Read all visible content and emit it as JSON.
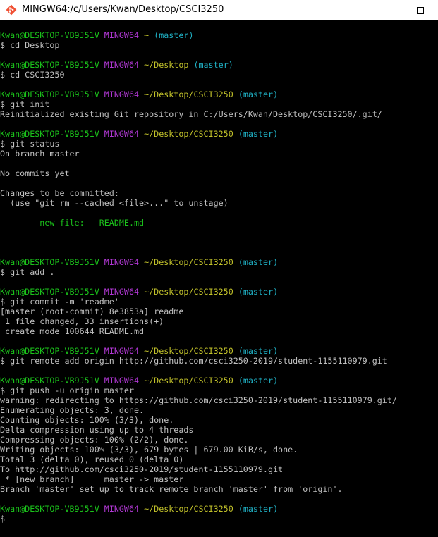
{
  "window": {
    "title": "MINGW64:/c/Users/Kwan/Desktop/CSCI3250"
  },
  "colors": {
    "user": "#1bc31b",
    "system": "#b439d8",
    "path": "#c1c12a",
    "branch": "#1fb0c4",
    "text": "#c0c0c0",
    "background": "#000000"
  },
  "prompt": {
    "user_host": "Kwan@DESKTOP-VB9J51V",
    "system": "MINGW64",
    "branch": "(master)",
    "symbol": "$"
  },
  "blocks": [
    {
      "path": "~",
      "command": "$ cd Desktop",
      "output": [
        ""
      ]
    },
    {
      "path": "~/Desktop",
      "command": "$ cd CSCI3250",
      "output": [
        ""
      ]
    },
    {
      "path": "~/Desktop/CSCI3250",
      "command": "$ git init",
      "output": [
        "Reinitialized existing Git repository in C:/Users/Kwan/Desktop/CSCI3250/.git/",
        ""
      ]
    },
    {
      "path": "~/Desktop/CSCI3250",
      "command": "$ git status",
      "output": [
        "On branch master",
        "",
        "No commits yet",
        "",
        "Changes to be committed:",
        "  (use \"git rm --cached <file>...\" to unstage)",
        "",
        "        new file:   README.md",
        "",
        "",
        ""
      ]
    },
    {
      "path": "~/Desktop/CSCI3250",
      "command": "$ git add .",
      "output": [
        ""
      ]
    },
    {
      "path": "~/Desktop/CSCI3250",
      "command": "$ git commit -m 'readme'",
      "output": [
        "[master (root-commit) 8e3853a] readme",
        " 1 file changed, 33 insertions(+)",
        " create mode 100644 README.md",
        ""
      ]
    },
    {
      "path": "~/Desktop/CSCI3250",
      "command": "$ git remote add origin http://github.com/csci3250-2019/student-1155110979.git",
      "output": [
        ""
      ]
    },
    {
      "path": "~/Desktop/CSCI3250",
      "command": "$ git push -u origin master",
      "output": [
        "warning: redirecting to https://github.com/csci3250-2019/student-1155110979.git/",
        "Enumerating objects: 3, done.",
        "Counting objects: 100% (3/3), done.",
        "Delta compression using up to 4 threads",
        "Compressing objects: 100% (2/2), done.",
        "Writing objects: 100% (3/3), 679 bytes | 679.00 KiB/s, done.",
        "Total 3 (delta 0), reused 0 (delta 0)",
        "To http://github.com/csci3250-2019/student-1155110979.git",
        " * [new branch]      master -> master",
        "Branch 'master' set up to track remote branch 'master' from 'origin'.",
        ""
      ]
    },
    {
      "path": "~/Desktop/CSCI3250",
      "command": "$",
      "output": []
    }
  ]
}
